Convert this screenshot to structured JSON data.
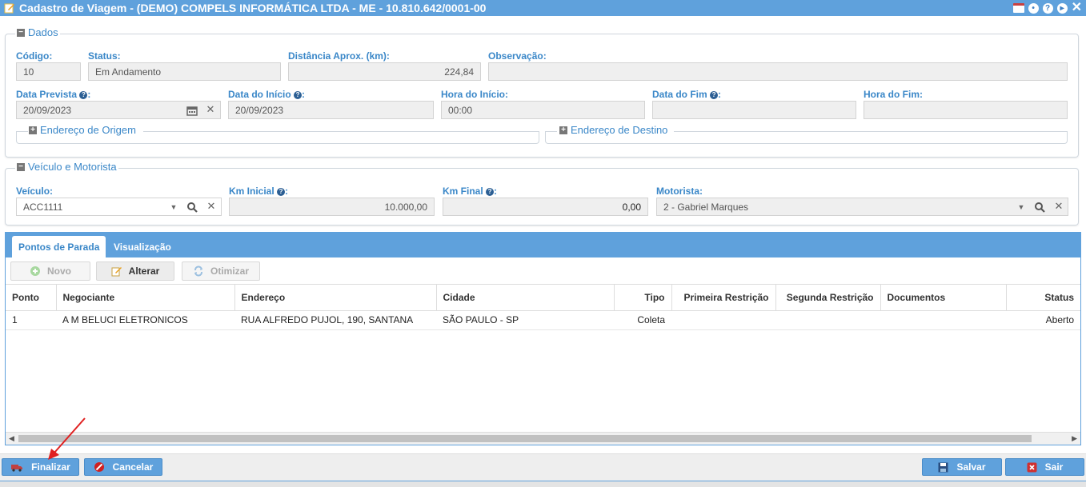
{
  "window": {
    "title": "Cadastro de Viagem - (DEMO) COMPELS INFORMÁTICA LTDA - ME - 10.810.642/0001-00",
    "icons": [
      "calendar-icon",
      "chat-icon",
      "help-icon",
      "play-icon",
      "close-icon"
    ]
  },
  "dados": {
    "legend": "Dados",
    "codigo_label": "Código:",
    "codigo_value": "10",
    "status_label": "Status:",
    "status_value": "Em Andamento",
    "distancia_label": "Distância Aprox. (km):",
    "distancia_value": "224,84",
    "observacao_label": "Observação:",
    "observacao_value": "",
    "data_prevista_label": "Data Prevista",
    "data_prevista_value": "20/09/2023",
    "data_inicio_label": "Data do Início",
    "data_inicio_value": "20/09/2023",
    "hora_inicio_label": "Hora do Início:",
    "hora_inicio_value": "00:00",
    "data_fim_label": "Data do Fim",
    "data_fim_value": "",
    "hora_fim_label": "Hora do Fim:",
    "hora_fim_value": "",
    "origem_legend": "Endereço de Origem",
    "destino_legend": "Endereço de Destino"
  },
  "veiculo": {
    "legend": "Veículo e Motorista",
    "veiculo_label": "Veículo:",
    "veiculo_value": "ACC1111",
    "km_inicial_label": "Km Inicial",
    "km_inicial_value": "10.000,00",
    "km_final_label": "Km Final",
    "km_final_value": "0,00",
    "motorista_label": "Motorista:",
    "motorista_value": "2 - Gabriel Marques"
  },
  "tabs": [
    {
      "label": "Pontos de Parada",
      "active": true
    },
    {
      "label": "Visualização",
      "active": false
    }
  ],
  "toolbar": {
    "novo": "Novo",
    "alterar": "Alterar",
    "otimizar": "Otimizar"
  },
  "grid": {
    "columns": [
      "Ponto",
      "Negociante",
      "Endereço",
      "Cidade",
      "Tipo",
      "Primeira Restrição",
      "Segunda Restrição",
      "Documentos",
      "Status"
    ],
    "rows": [
      [
        "1",
        "A M BELUCI ELETRONICOS",
        "RUA ALFREDO PUJOL, 190, SANTANA",
        "SÃO PAULO - SP",
        "Coleta",
        "",
        "",
        "",
        "Aberto"
      ]
    ]
  },
  "footer": {
    "finalizar": "Finalizar",
    "cancelar": "Cancelar",
    "salvar": "Salvar",
    "sair": "Sair"
  },
  "colors": {
    "accent": "#5fa1dc",
    "label": "#3a87c8",
    "annotation_arrow": "#e02020"
  }
}
